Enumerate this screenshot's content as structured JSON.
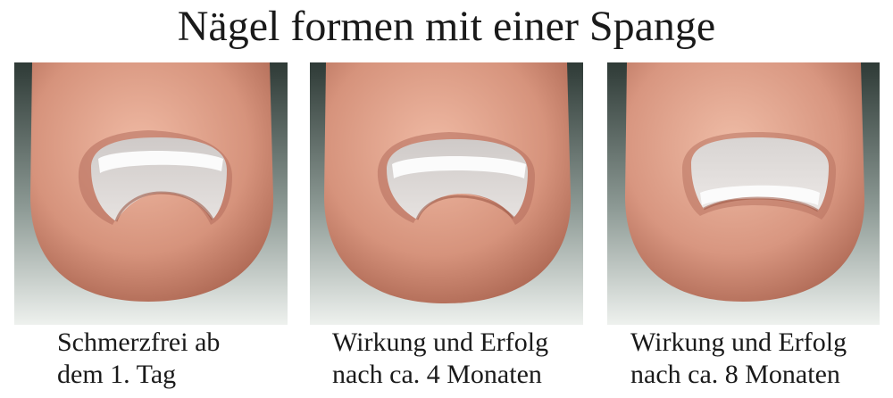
{
  "title": "Nägel formen mit einer Spange",
  "panels": [
    {
      "stage": "day-1",
      "caption_line1": "Schmerzfrei ab",
      "caption_line2": "dem 1. Tag"
    },
    {
      "stage": "month-4",
      "caption_line1": "Wirkung und Erfolg",
      "caption_line2": "nach ca. 4 Monaten"
    },
    {
      "stage": "month-8",
      "caption_line1": "Wirkung und Erfolg",
      "caption_line2": "nach ca. 8 Monaten"
    }
  ],
  "colors": {
    "background_dark": "#2f3b37",
    "background_light": "#eef1ee",
    "skin": "#d99a85",
    "skin_shadow": "#b06a55",
    "nail": "#d8d4d2",
    "brace": "#f7f7f7",
    "text": "#1a1a1a"
  }
}
